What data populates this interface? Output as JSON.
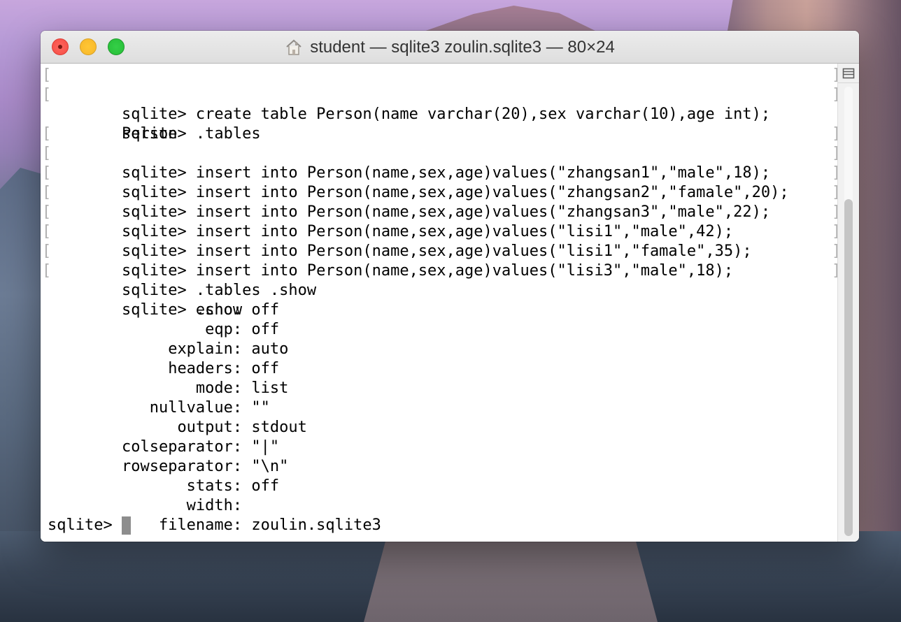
{
  "window": {
    "title": "student — sqlite3 zoulin.sqlite3 — 80×24"
  },
  "terminal": {
    "lines": [
      "sqlite> create table Person(name varchar(20),sex varchar(10),age int);",
      "sqlite> .tables",
      "Person",
      "sqlite> insert into Person(name,sex,age)values(\"zhangsan1\",\"male\",18);",
      "sqlite> insert into Person(name,sex,age)values(\"zhangsan2\",\"famale\",20);",
      "sqlite> insert into Person(name,sex,age)values(\"zhangsan3\",\"male\",22);",
      "sqlite> insert into Person(name,sex,age)values(\"lisi1\",\"male\",42);",
      "sqlite> insert into Person(name,sex,age)values(\"lisi1\",\"famale\",35);",
      "sqlite> insert into Person(name,sex,age)values(\"lisi3\",\"male\",18);",
      "sqlite> .tables .show",
      "sqlite> .show",
      "        echo: off",
      "         eqp: off",
      "     explain: auto",
      "     headers: off",
      "        mode: list",
      "   nullvalue: \"\"",
      "      output: stdout",
      "colseparator: \"|\"",
      "rowseparator: \"\\n\"",
      "       stats: off",
      "       width: ",
      "    filename: zoulin.sqlite3",
      "sqlite> "
    ]
  },
  "scrollbar": {
    "thumb_position": 0.25,
    "thumb_length": 0.75
  },
  "colors": {
    "close": "#f44d45",
    "minimize": "#f7b72b",
    "zoom": "#27be38",
    "terminal_text": "#000000",
    "cursor": "#8d8d8d",
    "title_text": "#333333"
  }
}
